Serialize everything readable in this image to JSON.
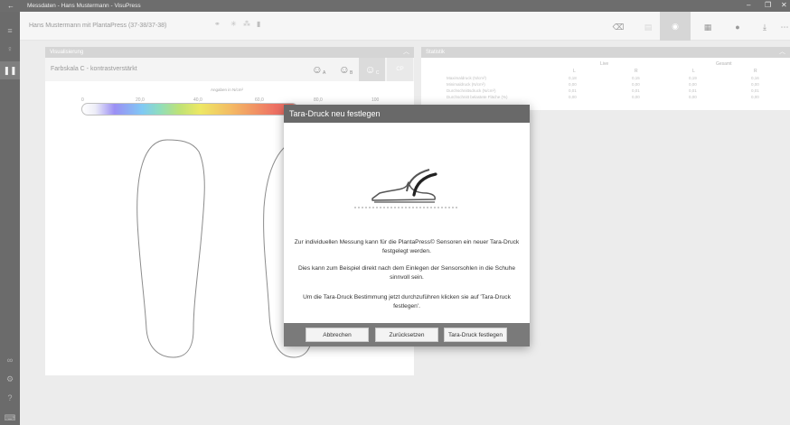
{
  "window": {
    "back_glyph": "←",
    "title": "Messdaten - Hans Mustermann - VisuPress",
    "controls": {
      "minimize": "–",
      "maximize": "❐",
      "close": "✕"
    }
  },
  "sidebar": {
    "items": [
      {
        "icon": "person-icon",
        "glyph": "♀"
      },
      {
        "icon": "footprints-icon",
        "glyph": "❚❚"
      },
      {
        "icon": "link-icon",
        "glyph": "∞"
      },
      {
        "icon": "settings-icon",
        "glyph": "⚙"
      },
      {
        "icon": "help-icon",
        "glyph": "?"
      },
      {
        "icon": "keyboard-icon",
        "glyph": "⌨"
      }
    ],
    "menu_glyph": "≡"
  },
  "header": {
    "patient": "Hans Mustermann",
    "device": "mit PlantaPress (37-38/37-38)",
    "toolbar": [
      {
        "icon": "eraser-icon",
        "glyph": "⌫"
      },
      {
        "icon": "save-icon",
        "glyph": "▤"
      },
      {
        "icon": "eye-icon",
        "glyph": "◉"
      },
      {
        "icon": "calendar-icon",
        "glyph": "▦"
      },
      {
        "icon": "record-icon",
        "glyph": "●"
      },
      {
        "icon": "download-icon",
        "glyph": "⤓"
      },
      {
        "icon": "more-icon",
        "glyph": "⋯"
      }
    ]
  },
  "visualisierung": {
    "title": "Visualisierung",
    "color_scale": "Farbskala C - kontrastverstärkt",
    "scale_buttons": [
      "A",
      "B",
      "C",
      "CP"
    ],
    "legend_title": "Angaben in N/cm²",
    "ticks": [
      "0",
      "20,0",
      "40,0",
      "60,0",
      "80,0",
      "100"
    ]
  },
  "statistik": {
    "title": "Statistik",
    "group_live": "Live",
    "group_gesamt": "Gesamt",
    "col_l": "L",
    "col_r": "R",
    "rows": [
      {
        "label": "Maximaldruck (N/cm²)",
        "live_l": "0,18",
        "live_r": "0,15",
        "ges_l": "0,19",
        "ges_r": "0,16"
      },
      {
        "label": "Minimaldruck (N/cm²)",
        "live_l": "0,00",
        "live_r": "0,00",
        "ges_l": "0,00",
        "ges_r": "0,00"
      },
      {
        "label": "Durchschnittsdruck (N/cm²)",
        "live_l": "0,01",
        "live_r": "0,01",
        "ges_l": "0,01",
        "ges_r": "0,01"
      },
      {
        "label": "Durchschnitt belastete Fläche (%)",
        "live_l": "0,00",
        "live_r": "0,00",
        "ges_l": "0,00",
        "ges_r": "0,00"
      }
    ]
  },
  "dialog": {
    "title": "Tara-Druck neu festlegen",
    "paragraphs": [
      "Zur individuellen Messung kann für die PlantaPress© Sensoren ein neuer Tara-Druck festgelegt werden.",
      "Dies kann zum Beispiel direkt nach dem Einlegen der Sensorsohlen in die Schuhe sinnvoll sein.",
      "Um die Tara-Druck Bestimmung jetzt durchzuführen klicken sie auf 'Tara-Druck festlegen'."
    ],
    "buttons": {
      "cancel": "Abbrechen",
      "reset": "Zurücksetzen",
      "confirm": "Tara-Druck festlegen"
    }
  }
}
